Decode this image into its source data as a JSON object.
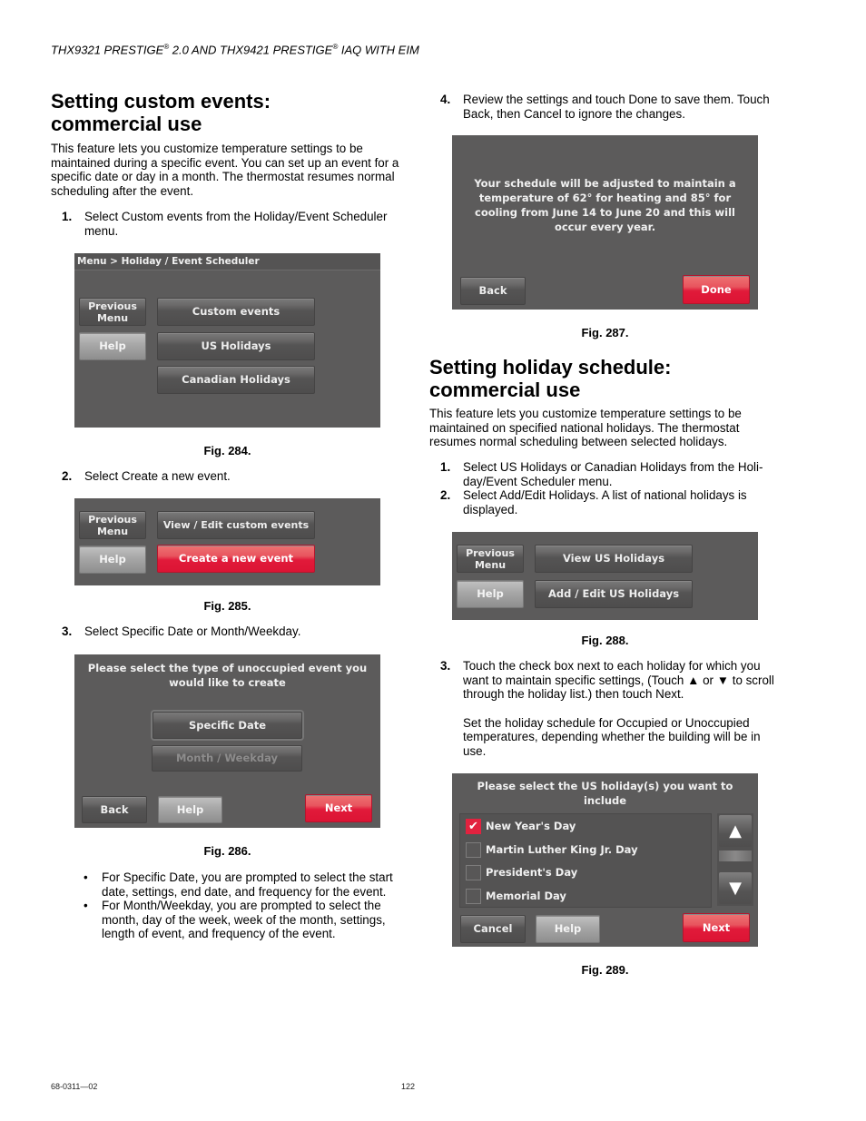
{
  "header": {
    "part1": "THX9321 PRESTIGE",
    "reg": "®",
    "part2": " 2.0 AND THX9421 PRESTIGE",
    "part3": " IAQ WITH EIM"
  },
  "left": {
    "title_line1": "Setting custom events:",
    "title_line2": "commercial use",
    "intro": "This feature lets you customize temperature settings to be maintained during a specific event. You can set up an event for a specific date or day in a month. The thermostat resumes normal scheduling after the event.",
    "steps": [
      {
        "num": "1.",
        "text": "Select Custom events from the Holiday/Event Scheduler menu."
      },
      {
        "num": "2.",
        "text": "Select Create a new event."
      },
      {
        "num": "3.",
        "text": "Select Specific Date or Month/Weekday."
      }
    ],
    "bullets": [
      "For Specific Date, you are prompted to select the start date, settings, end date, and frequency for the event.",
      "For Month/Weekday, you are prompted to select the month, day of the week, week of the month, settings, length of event, and frequency of the event."
    ],
    "fig284": {
      "caption": "Fig. 284.",
      "breadcrumb": "Menu > Holiday / Event Scheduler",
      "previous_menu": "Previous Menu",
      "help": "Help",
      "custom_events": "Custom events",
      "us_holidays": "US Holidays",
      "canadian_holidays": "Canadian Holidays"
    },
    "fig285": {
      "caption": "Fig. 285.",
      "previous_menu": "Previous Menu",
      "help": "Help",
      "view_edit": "View / Edit custom events",
      "create_new": "Create a new event"
    },
    "fig286": {
      "caption": "Fig. 286.",
      "prompt": "Please select the type of unoccupied event you would like to create",
      "specific_date": "Specific Date",
      "month_weekday": "Month / Weekday",
      "back": "Back",
      "help": "Help",
      "next": "Next"
    }
  },
  "right": {
    "step4": {
      "num": "4.",
      "text": "Review the settings and touch Done to save them. Touch Back, then Cancel to ignore the changes."
    },
    "fig287": {
      "caption": "Fig. 287.",
      "message": "Your schedule will be adjusted to maintain a temperature of 62° for heating and 85° for cooling from June 14 to June 20 and this will occur every year.",
      "back": "Back",
      "done": "Done"
    },
    "title_line1": "Setting holiday schedule:",
    "title_line2": "commercial use",
    "intro": "This feature lets you customize temperature settings to be maintained on specified national holidays. The thermostat resumes normal scheduling between selected holidays.",
    "steps": [
      {
        "num": "1.",
        "text": "Select US Holidays or Canadian Holidays from the Holi-day/Event Scheduler menu."
      },
      {
        "num": "2.",
        "text": "Select Add/Edit Holidays. A list of national holidays is displayed."
      }
    ],
    "step3": {
      "num": "3.",
      "text_a": "Touch the check box next to each holiday for which you want to maintain specific settings, (Touch ",
      "up_glyph": "▲",
      "text_b": " or ",
      "down_glyph": "▼",
      "text_c": " to scroll through the holiday list.) then touch Next.",
      "note": "Set the holiday schedule for Occupied or Unoccupied temperatures, depending whether the building will be in use."
    },
    "fig288": {
      "caption": "Fig. 288.",
      "previous_menu": "Previous Menu",
      "help": "Help",
      "view_us": "View US Holidays",
      "add_edit_us": "Add / Edit US Holidays"
    },
    "fig289": {
      "caption": "Fig. 289.",
      "prompt": "Please select the US holiday(s) you want to include",
      "holidays": [
        {
          "label": "New Year's Day",
          "checked": true
        },
        {
          "label": "Martin Luther King Jr. Day",
          "checked": false
        },
        {
          "label": "President's Day",
          "checked": false
        },
        {
          "label": "Memorial Day",
          "checked": false
        }
      ],
      "check_glyph": "✔",
      "up_glyph": "▲",
      "down_glyph": "▼",
      "cancel": "Cancel",
      "help": "Help",
      "next": "Next"
    }
  },
  "footer": {
    "doc_number": "68-0311—02",
    "page_number": "122"
  },
  "colors": {
    "screen_bg": "#5c5b5b",
    "accent_red": "#e11a3a",
    "help_button": "#a9a9a9"
  }
}
